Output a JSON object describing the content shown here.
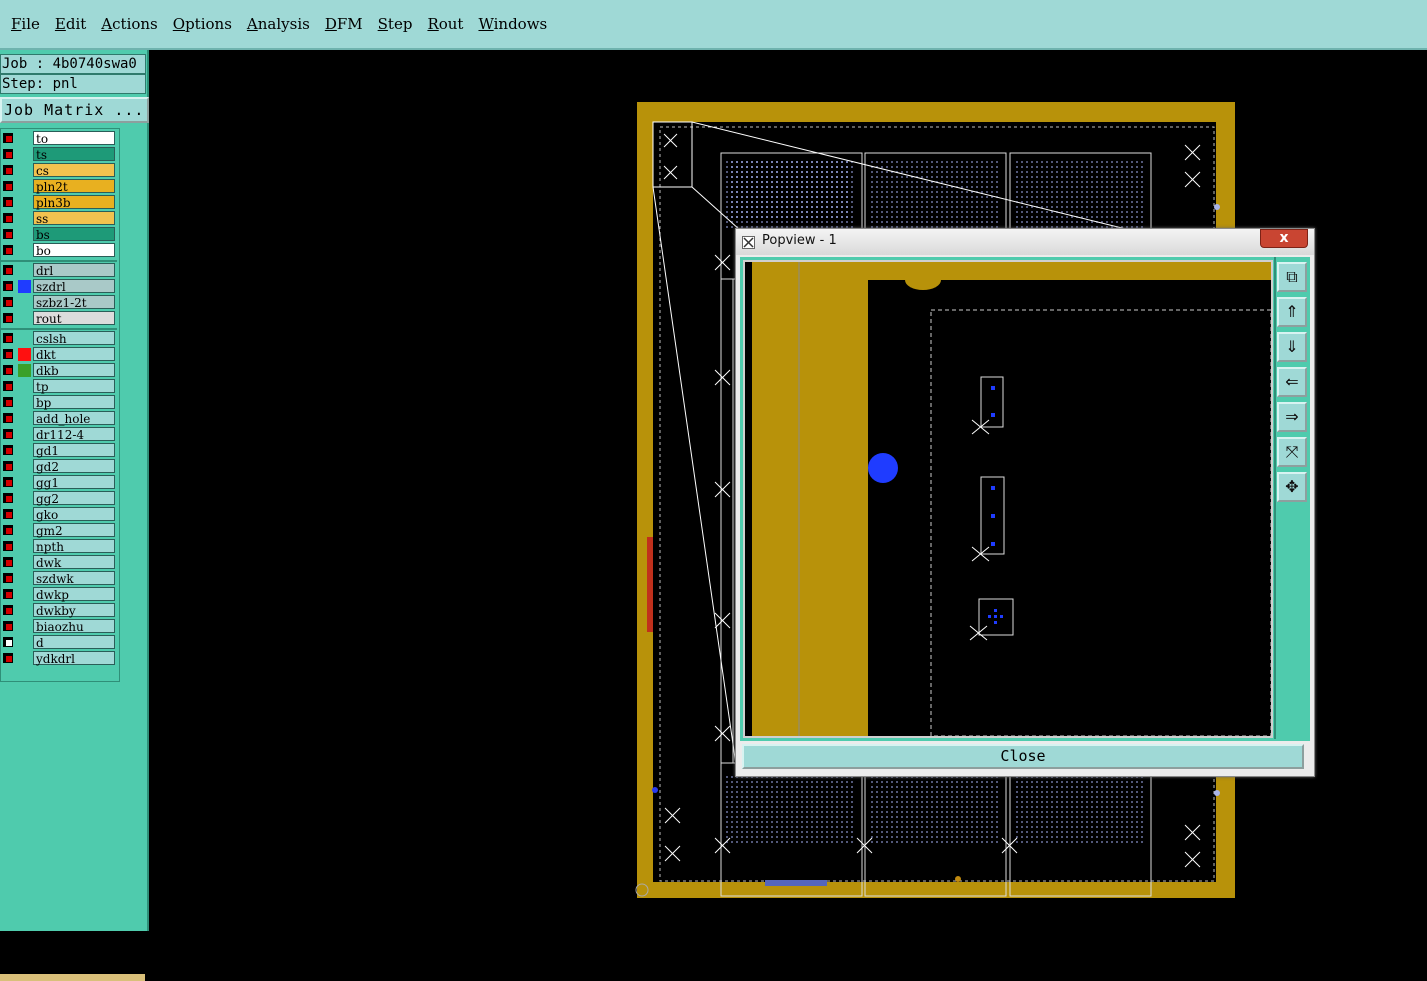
{
  "menubar": {
    "items": [
      "File",
      "Edit",
      "Actions",
      "Options",
      "Analysis",
      "DFM",
      "Step",
      "Rout",
      "Windows"
    ],
    "mnemonics": [
      "F",
      "E",
      "A",
      "O",
      "A",
      "D",
      "S",
      "R",
      "W"
    ]
  },
  "info": {
    "job": "Job : 4b0740swa0",
    "step": "Step: pnl",
    "job_matrix": "Job Matrix ..."
  },
  "layers": [
    {
      "name": "to",
      "bg": "#ffffff",
      "color": ""
    },
    {
      "name": "ts",
      "bg": "#1e9a78",
      "color": ""
    },
    {
      "name": "cs",
      "bg": "#f2c24f",
      "color": ""
    },
    {
      "name": "pln2t",
      "bg": "#e8b020",
      "color": ""
    },
    {
      "name": "pln3b",
      "bg": "#e8b020",
      "color": ""
    },
    {
      "name": "ss",
      "bg": "#f2c24f",
      "color": ""
    },
    {
      "name": "bs",
      "bg": "#1e9a78",
      "color": ""
    },
    {
      "name": "bo",
      "bg": "#ffffff",
      "color": ""
    },
    {
      "name": "drl",
      "bg": "#a9c9c8",
      "color": ""
    },
    {
      "name": "szdrl",
      "bg": "#a9c9c8",
      "color": "#1f3cff"
    },
    {
      "name": "szbz1-2t",
      "bg": "#a9c9c8",
      "color": ""
    },
    {
      "name": "rout",
      "bg": "#dcdcdc",
      "color": ""
    },
    {
      "name": "cslsh",
      "bg": "#9fd9d6",
      "color": ""
    },
    {
      "name": "dkt",
      "bg": "#9fd9d6",
      "color": "#ff1010"
    },
    {
      "name": "dkb",
      "bg": "#9fd9d6",
      "color": "#3aa02a"
    },
    {
      "name": "tp",
      "bg": "#9fd9d6",
      "color": ""
    },
    {
      "name": "bp",
      "bg": "#9fd9d6",
      "color": ""
    },
    {
      "name": "add_hole",
      "bg": "#9fd9d6",
      "color": ""
    },
    {
      "name": "dr112-4",
      "bg": "#9fd9d6",
      "color": ""
    },
    {
      "name": "gd1",
      "bg": "#9fd9d6",
      "color": ""
    },
    {
      "name": "gd2",
      "bg": "#9fd9d6",
      "color": ""
    },
    {
      "name": "gg1",
      "bg": "#9fd9d6",
      "color": ""
    },
    {
      "name": "gg2",
      "bg": "#9fd9d6",
      "color": ""
    },
    {
      "name": "gko",
      "bg": "#9fd9d6",
      "color": ""
    },
    {
      "name": "gm2",
      "bg": "#9fd9d6",
      "color": ""
    },
    {
      "name": "npth",
      "bg": "#9fd9d6",
      "color": ""
    },
    {
      "name": "dwk",
      "bg": "#9fd9d6",
      "color": ""
    },
    {
      "name": "szdwk",
      "bg": "#9fd9d6",
      "color": ""
    },
    {
      "name": "dwkp",
      "bg": "#9fd9d6",
      "color": ""
    },
    {
      "name": "dwkby",
      "bg": "#9fd9d6",
      "color": ""
    },
    {
      "name": "biaozhu",
      "bg": "#9fd9d6",
      "color": ""
    },
    {
      "name": "d",
      "bg": "#9fd9d6",
      "color": ""
    },
    {
      "name": "ydkdrl",
      "bg": "#9fd9d6",
      "color": ""
    }
  ],
  "popview": {
    "title": "Popview - 1",
    "close_x": "x",
    "close_button": "Close",
    "tools": [
      "zoom-window-icon",
      "pan-up-icon",
      "pan-down-icon",
      "pan-left-icon",
      "pan-right-icon",
      "zoom-home-icon",
      "zoom-fit-icon"
    ]
  },
  "colors": {
    "copper": "#b8920a",
    "panel_teal": "#4fcbad",
    "menu_teal": "#9fd9d6",
    "pad_blue": "#1f3cff"
  }
}
